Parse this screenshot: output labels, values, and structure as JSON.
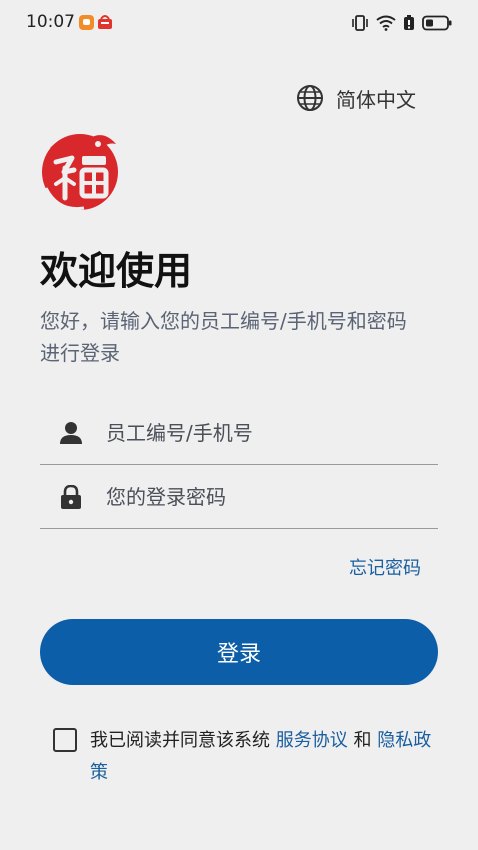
{
  "status_bar": {
    "time": "10:07",
    "icons": [
      "app-notification-icon",
      "app-notification-icon",
      "vibrate-icon",
      "wifi-icon",
      "battery-saver-icon",
      "battery-icon"
    ]
  },
  "language": {
    "label": "简体中文",
    "icon": "globe-icon"
  },
  "logo": {
    "icon": "fu-logo",
    "color": "#d8282c"
  },
  "welcome": {
    "title": "欢迎使用",
    "subtitle_line1": "您好，请输入您的员工编号/手机号和密码",
    "subtitle_line2": "进行登录"
  },
  "form": {
    "username_placeholder": "员工编号/手机号",
    "password_placeholder": "您的登录密码",
    "forgot_password": "忘记密码",
    "login_button": "登录"
  },
  "agreement": {
    "text_prefix": "我已阅读并同意该系统",
    "service_link": "服务协议",
    "conjunction": "和",
    "privacy_link": "隐私政策"
  },
  "colors": {
    "accent": "#0c5ea8",
    "link": "#1a5fa0",
    "background": "#efefef",
    "logo": "#d8282c"
  }
}
